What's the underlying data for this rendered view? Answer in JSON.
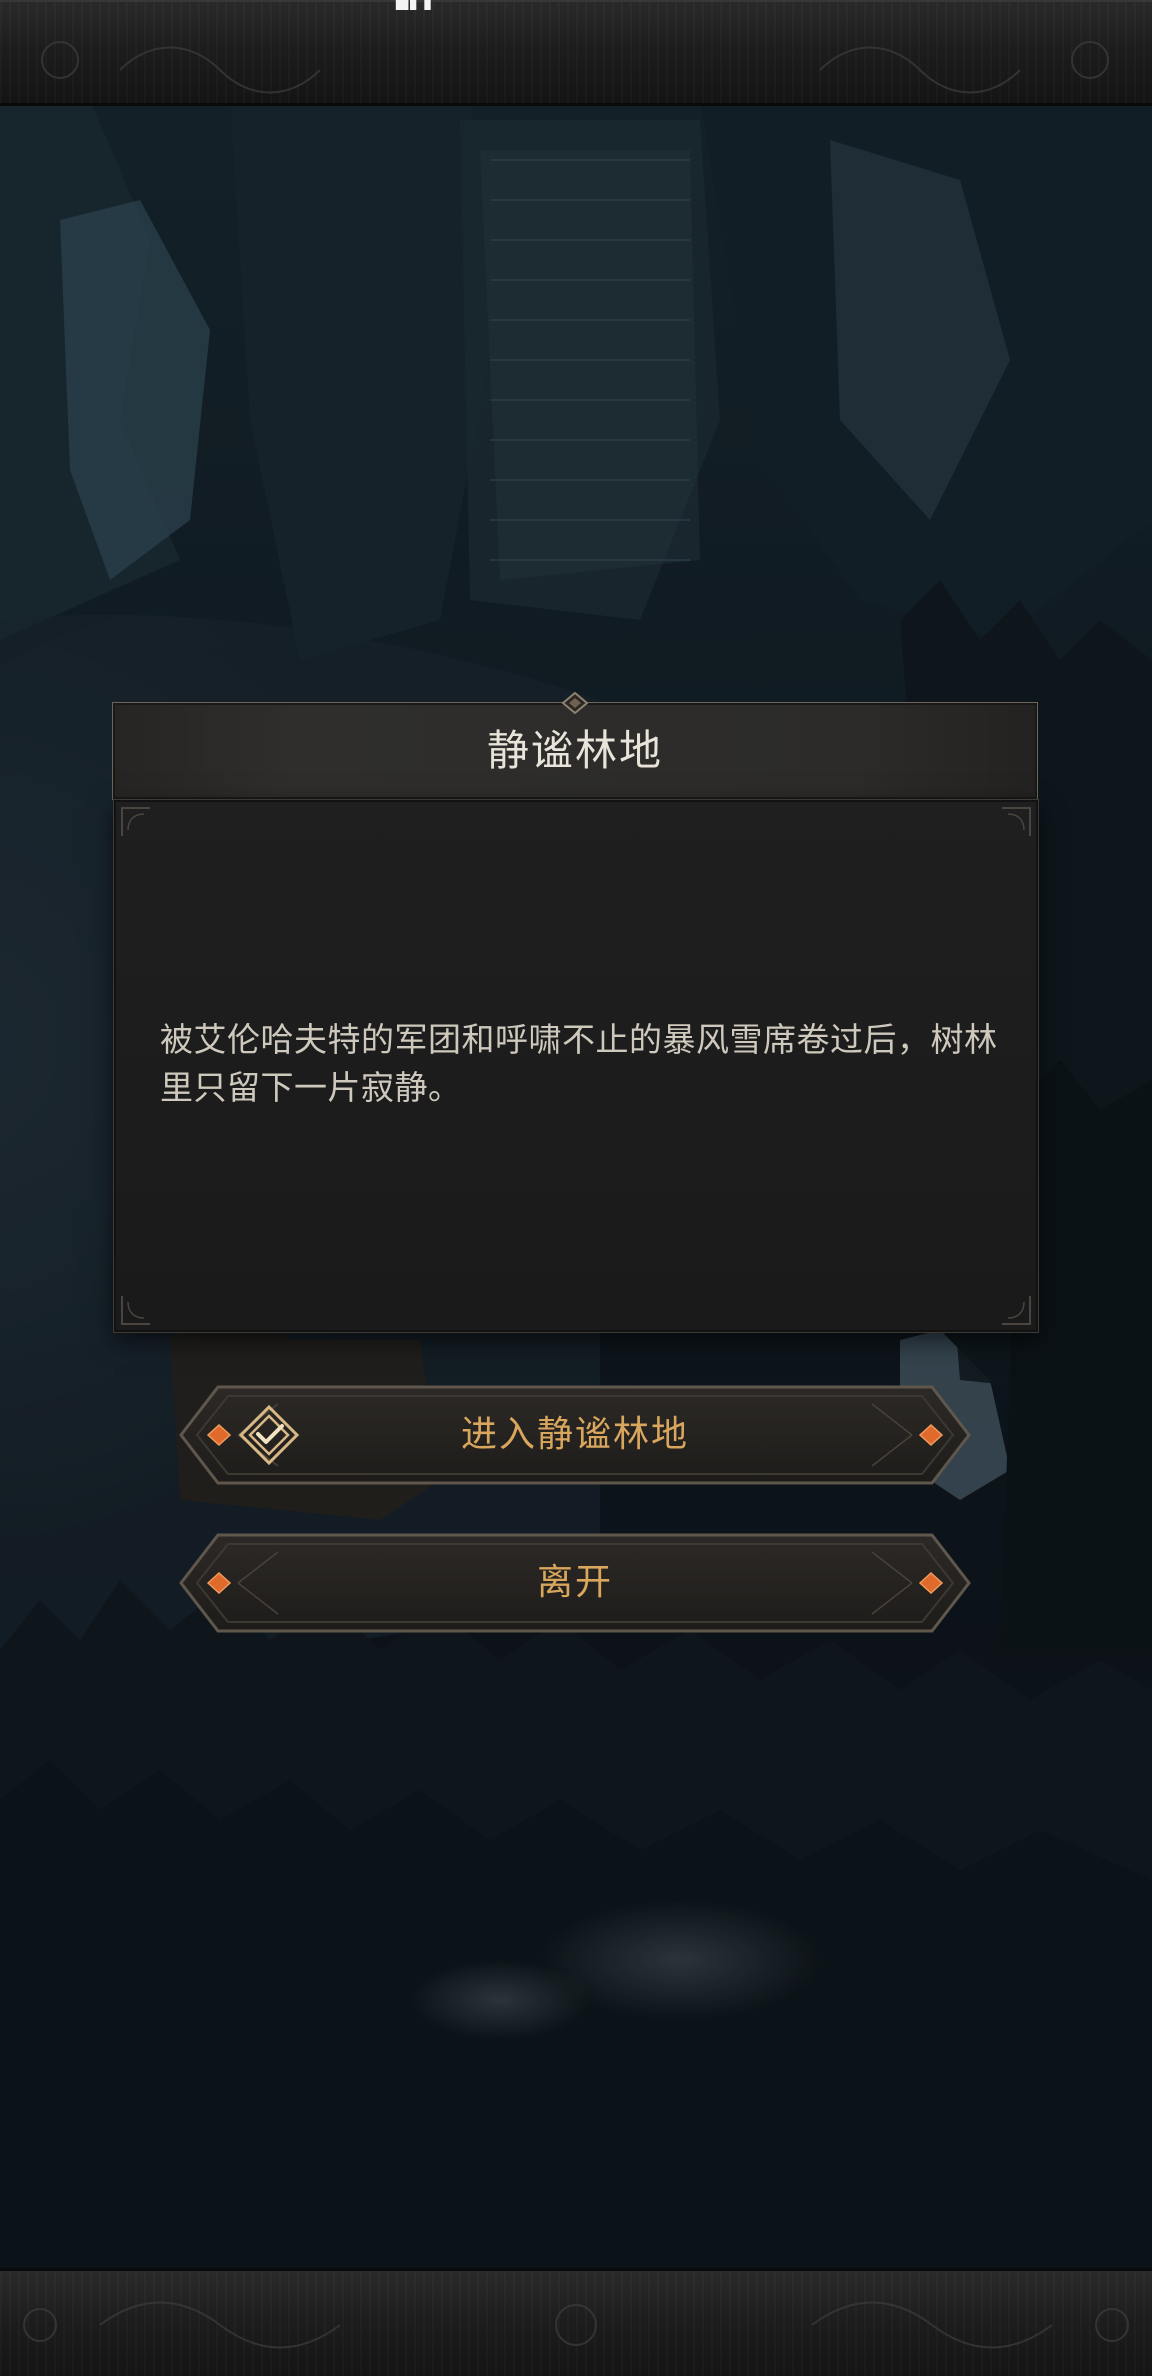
{
  "status_bar": {
    "glyph": "█▌▌"
  },
  "dialog": {
    "title": "静谧林地",
    "body_text": "被艾伦哈夫特的军团和呼啸不止的暴风雪席卷过后，树林里只留下一片寂静。"
  },
  "actions": {
    "enter_label": "进入静谧林地",
    "enter_icon": "seal-check-icon",
    "leave_label": "离开"
  },
  "colors": {
    "accent_gold": "#d8a65c",
    "gem_orange": "#e06a2c",
    "panel_bg": "#1c1c1c",
    "frame_bg": "#1d1d1e"
  }
}
